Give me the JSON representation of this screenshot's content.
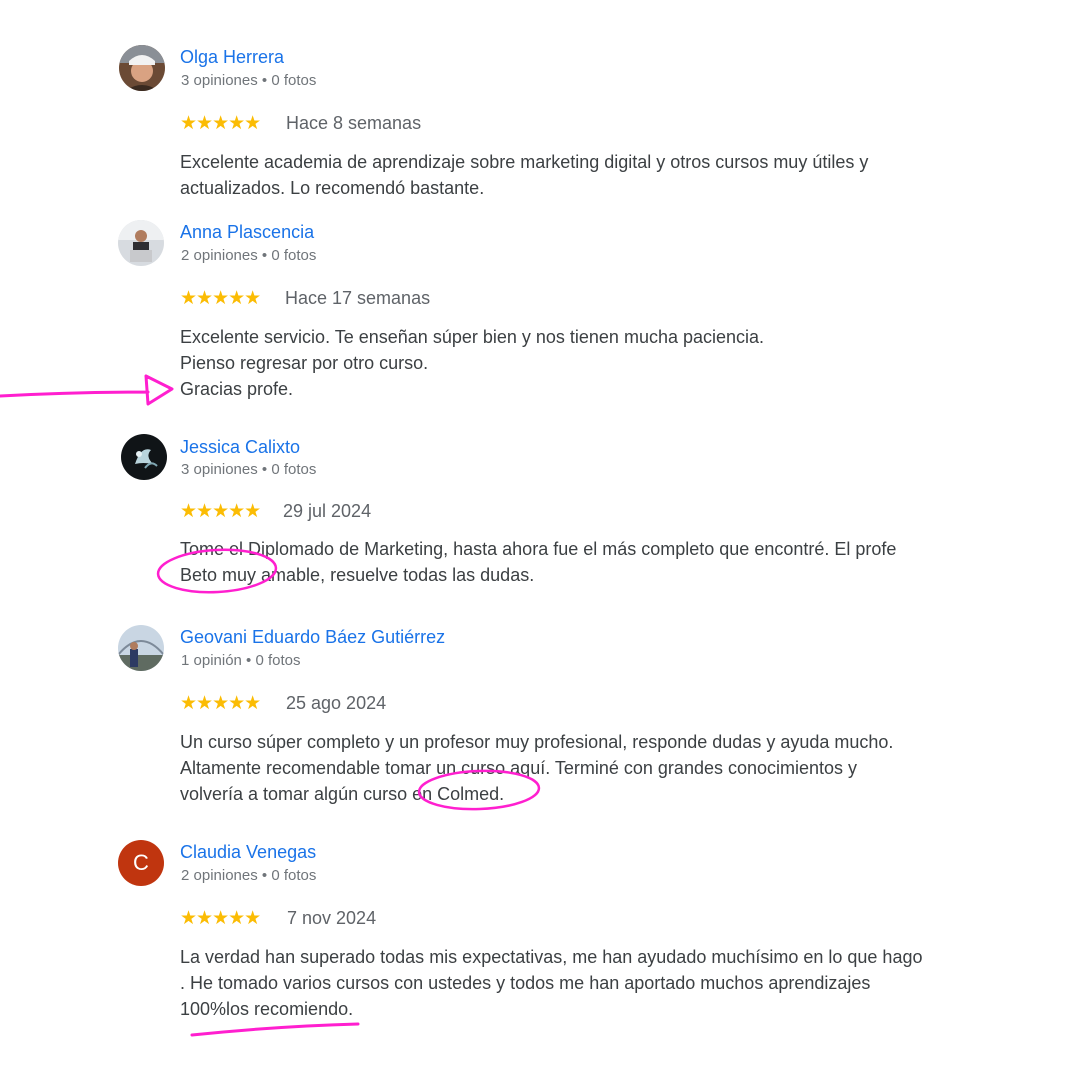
{
  "reviews": [
    {
      "name": "Olga Herrera",
      "meta": "3 opiniones • 0 fotos",
      "stars": "★★★★★",
      "date": "Hace 8 semanas",
      "text": "Excelente academia de aprendizaje sobre marketing digital y otros cursos muy útiles y\nactualizados. Lo recomendó bastante."
    },
    {
      "name": "Anna Plascencia",
      "meta": "2 opiniones • 0 fotos",
      "stars": "★★★★★",
      "date": "Hace 17 semanas",
      "text": "Excelente servicio. Te enseñan súper bien y nos tienen mucha paciencia.\nPienso regresar por otro curso.\nGracias profe."
    },
    {
      "name": "Jessica Calixto",
      "meta": "3 opiniones • 0 fotos",
      "stars": "★★★★★",
      "date": "29 jul 2024",
      "text": "Tome el Diplomado de Marketing, hasta ahora fue el más completo que encontré. El profe\nBeto muy amable, resuelve todas las dudas."
    },
    {
      "name": "Geovani Eduardo Báez Gutiérrez",
      "meta": "1 opinión • 0 fotos",
      "stars": "★★★★★",
      "date": "25 ago 2024",
      "text": "Un curso súper completo y un profesor muy profesional, responde dudas y ayuda mucho.\nAltamente recomendable tomar un curso aquí. Terminé con grandes conocimientos y\nvolvería a tomar algún curso en Colmed."
    },
    {
      "name": "Claudia Venegas",
      "meta": "2 opiniones • 0 fotos",
      "stars": "★★★★★",
      "date": "7 nov 2024",
      "avatar_letter": "C",
      "text": "La verdad han superado todas mis expectativas, me han ayudado muchísimo en lo que hago\n. He tomado varios cursos con ustedes y todos me han aportado muchos aprendizajes\n100%los recomiendo."
    }
  ],
  "colors": {
    "name_link": "#1a73e8",
    "star": "#fbbc04",
    "annotation": "#ff1fcf",
    "letter_avatar": "#c0350f"
  }
}
